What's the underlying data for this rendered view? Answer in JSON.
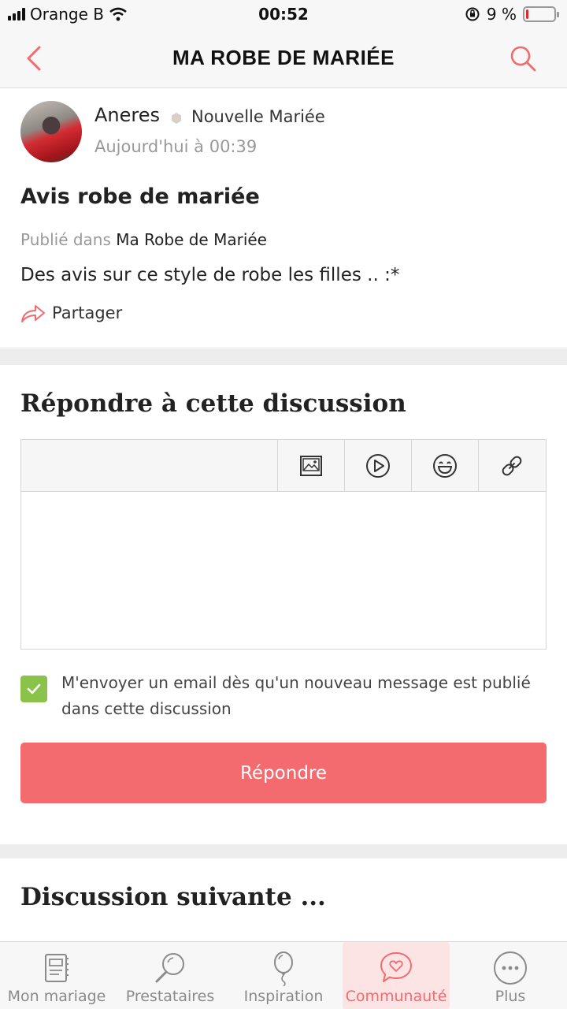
{
  "status_bar": {
    "carrier": "Orange B",
    "time": "00:52",
    "battery_percent_text": "9 %",
    "battery_level": 0.09
  },
  "header": {
    "title": "MA ROBE DE MARIÉE",
    "back_icon": "chevron-left-icon",
    "search_icon": "search-icon"
  },
  "post": {
    "author": "Aneres",
    "role": "Nouvelle Mariée",
    "time": "Aujourd'hui à 00:39",
    "title": "Avis robe de mariée",
    "published_prefix": "Publié dans",
    "category": "Ma Robe de Mariée",
    "body": "Des avis sur ce style de robe les filles .. :*",
    "share_label": "Partager"
  },
  "reply": {
    "title": "Répondre à cette discussion",
    "toolbar": [
      "image-icon",
      "video-icon",
      "emoji-icon",
      "link-icon"
    ],
    "editor_value": "",
    "notify_checked": true,
    "notify_label": "M'envoyer un email dès qu'un nouveau message est publié dans cette discussion",
    "submit_label": "Répondre"
  },
  "next_discussion": {
    "title": "Discussion suivante ..."
  },
  "colors": {
    "accent": "#f46b6f",
    "check": "#8bc34a"
  },
  "tabbar": {
    "active": "Communauté",
    "items": [
      {
        "label": "Mon mariage",
        "icon": "planner-icon"
      },
      {
        "label": "Prestataires",
        "icon": "magnifier-icon"
      },
      {
        "label": "Inspiration",
        "icon": "balloon-icon"
      },
      {
        "label": "Communauté",
        "icon": "chat-heart-icon"
      },
      {
        "label": "Plus",
        "icon": "more-dots-icon"
      }
    ]
  }
}
